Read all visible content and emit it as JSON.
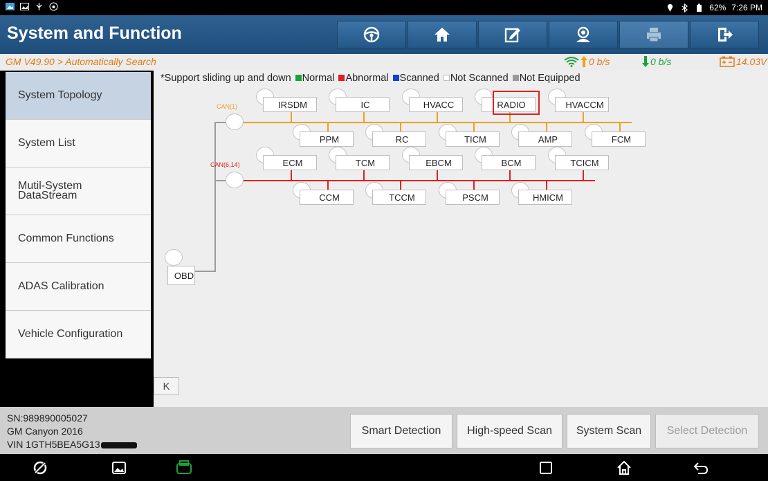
{
  "statusbar": {
    "battery": "62%",
    "time": "7:26 PM"
  },
  "title": "System and Function",
  "toolbar": {
    "icons": [
      "steering-wheel-icon",
      "home-icon",
      "report-icon",
      "user-support-icon",
      "print-icon",
      "exit-icon"
    ]
  },
  "breadcrumb": "GM V49.90 > Automatically Search",
  "network": {
    "upload": "0 b/s",
    "download": "0 b/s",
    "voltage": "14.03V"
  },
  "sidebar": {
    "items": [
      {
        "label": "System Topology"
      },
      {
        "label": "System List"
      },
      {
        "label": "Mutil-System DataStream"
      },
      {
        "label": "Common Functions"
      },
      {
        "label": "ADAS Calibration"
      },
      {
        "label": "Vehicle Configuration"
      }
    ]
  },
  "legend": {
    "note": "*Support sliding up and down",
    "normal": "Normal",
    "abnormal": "Abnormal",
    "scanned": "Scanned",
    "not_scanned": "Not Scanned",
    "not_equipped": "Not Equipped",
    "colors": {
      "normal": "#1ba13c",
      "abnormal": "#e02020",
      "scanned": "#1a3cd9",
      "not_scanned": "#ffffff",
      "not_equipped": "#9a9a9a"
    }
  },
  "topology": {
    "obd": "OBD",
    "buses": [
      {
        "label": "CAN(1)",
        "color": "#f0a020",
        "top": [
          "IRSDM",
          "IC",
          "HVACC",
          "RADIO",
          "HVACCM"
        ],
        "bottom": [
          "PPM",
          "RC",
          "TICM",
          "AMP",
          "FCM"
        ]
      },
      {
        "label": "CAN(6,14)",
        "color": "#e02020",
        "top": [
          "ECM",
          "TCM",
          "EBCM",
          "BCM",
          "TCICM"
        ],
        "bottom": [
          "CCM",
          "TCCM",
          "PSCM",
          "HMICM"
        ]
      }
    ],
    "collapse": "K"
  },
  "vehicle": {
    "sn": "SN:989890005027",
    "model": "GM Canyon 2016",
    "vin": "VIN 1GTH5BEA5G13"
  },
  "actions": {
    "smart_detection": "Smart Detection",
    "high_speed_scan": "High-speed Scan",
    "system_scan": "System Scan",
    "select_detection": "Select Detection"
  }
}
